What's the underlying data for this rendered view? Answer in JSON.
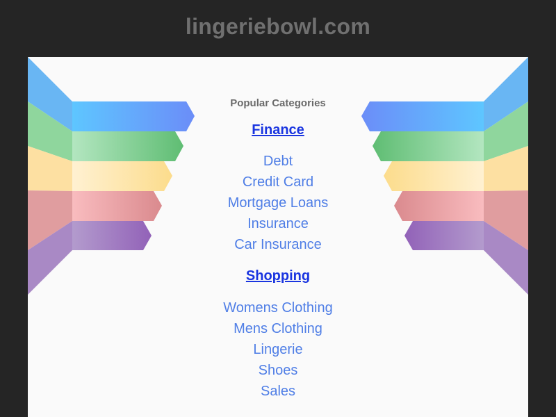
{
  "site": {
    "title": "lingeriebowl.com"
  },
  "main": {
    "popular_label": "Popular Categories",
    "categories": [
      {
        "heading": "Finance",
        "links": [
          "Debt",
          "Credit Card",
          "Mortgage Loans",
          "Insurance",
          "Car Insurance"
        ]
      },
      {
        "heading": "Shopping",
        "links": [
          "Womens Clothing",
          "Mens Clothing",
          "Lingerie",
          "Shoes",
          "Sales"
        ]
      }
    ]
  },
  "colors": {
    "page_background": "#252525",
    "panel_background": "#fafafa",
    "title_color": "#707070",
    "heading_link": "#1a35e0",
    "link": "#4f7ee6",
    "ribbon_blue": "#5ab4ff",
    "ribbon_green": "#66c27a",
    "ribbon_yellow": "#fde39a",
    "ribbon_red": "#e08f94",
    "ribbon_purple": "#9a75be"
  }
}
